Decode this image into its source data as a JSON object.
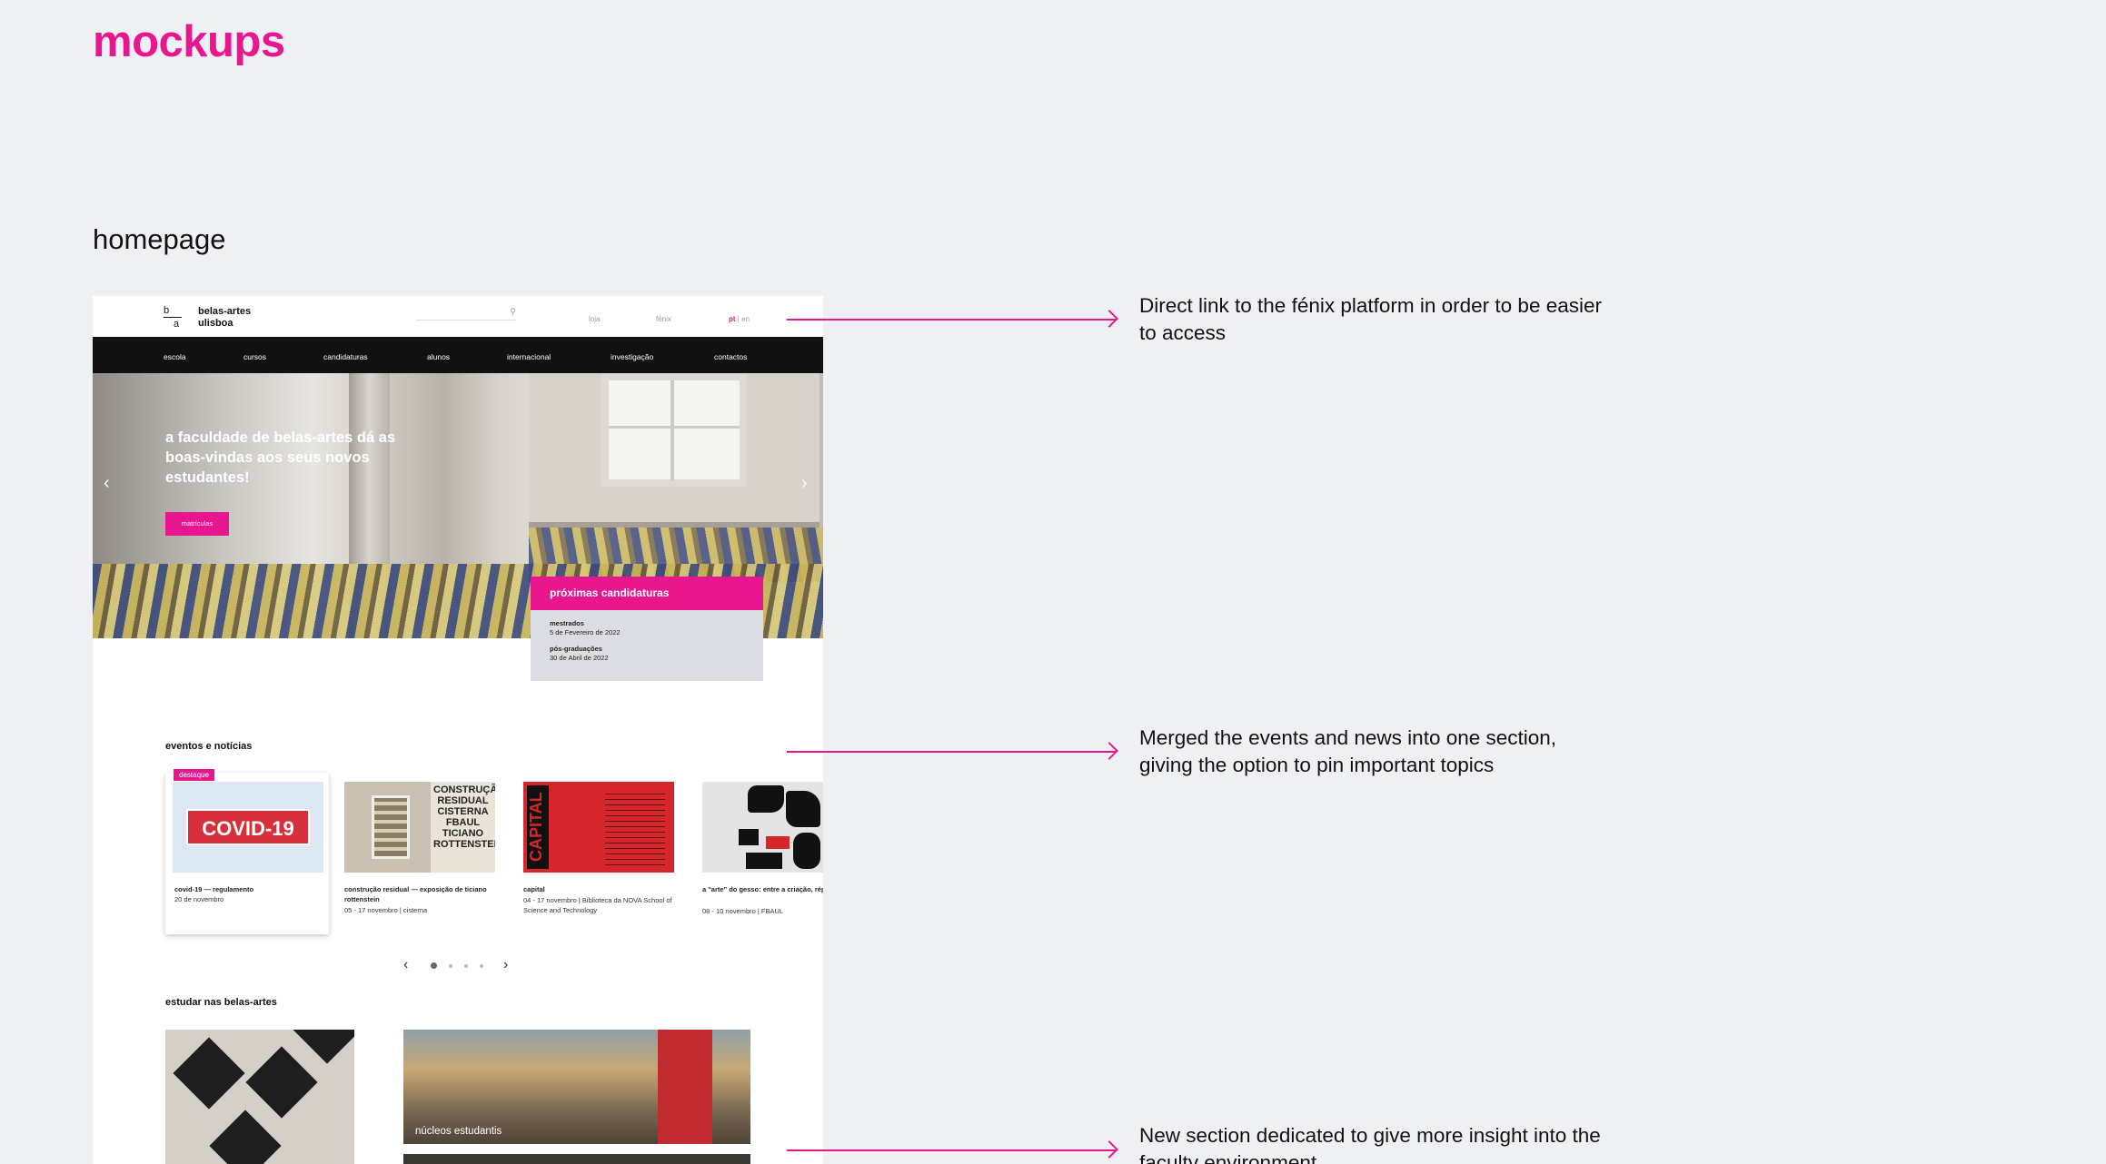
{
  "page": {
    "title": "mockups",
    "section_title": "homepage"
  },
  "mockup": {
    "header": {
      "logo_mark_top": "b",
      "logo_mark_bottom": "a",
      "logo_line1": "belas-artes",
      "logo_line2": "ulisboa",
      "search_icon": "search-icon",
      "links": [
        "loja",
        "fénix"
      ],
      "lang_active": "pt",
      "lang_separator": " | ",
      "lang_other": "en"
    },
    "nav": [
      "escola",
      "cursos",
      "candidaturas",
      "alunos",
      "internacional",
      "investigação",
      "contactos"
    ],
    "hero": {
      "headline": "a faculdade de belas-artes dá as boas-vindas aos seus novos estudantes!",
      "button": "matrículas",
      "prev_icon": "chevron-left-icon",
      "next_icon": "chevron-right-icon",
      "prev_glyph": "‹",
      "next_glyph": "›"
    },
    "candidaturas": {
      "title": "próximas candidaturas",
      "items": [
        {
          "name": "mestrados",
          "date": "5 de Fevereiro de 2022"
        },
        {
          "name": "pós-graduações",
          "date": "30 de Abril de 2022"
        }
      ]
    },
    "events": {
      "heading": "eventos e notícias",
      "badge": "destaque",
      "items": [
        {
          "title": "covid-19 — regulamento",
          "meta": "20 de novembro",
          "thumb_text": "COVID-19"
        },
        {
          "title": "construção residual — exposição de ticiano rottenstein",
          "meta": "05 - 17 novembro | cisterna",
          "thumb_text": "CONSTRUÇÃO RESIDUAL CISTERNA FBAUL TICIANO ROTTENSTEIN"
        },
        {
          "title": "capital",
          "meta": "04 - 17 novembro | Biblioteca da NOVA School of Science and Technology",
          "thumb_text": "CAPITAL"
        },
        {
          "title": "a \"arte\" do gesso: entre a criação, réplica, estudo e preservação",
          "meta": "08 - 10 novembro | FBAUL",
          "thumb_text": ""
        }
      ],
      "pager": {
        "prev_glyph": "‹",
        "next_glyph": "›",
        "dots": 4,
        "active": 1
      }
    },
    "study": {
      "heading": "estudar nas belas-artes",
      "card_label": "núcleos estudantis"
    }
  },
  "annotations": [
    "Direct link to the fénix platform in order to be easier to access",
    "Merged the events and news into one section, giving the option to pin important topics",
    "New section dedicated to give more insight into the faculty environment"
  ],
  "colors": {
    "accent": "#e8168f",
    "background": "#eff0f4",
    "nav": "#111111"
  }
}
